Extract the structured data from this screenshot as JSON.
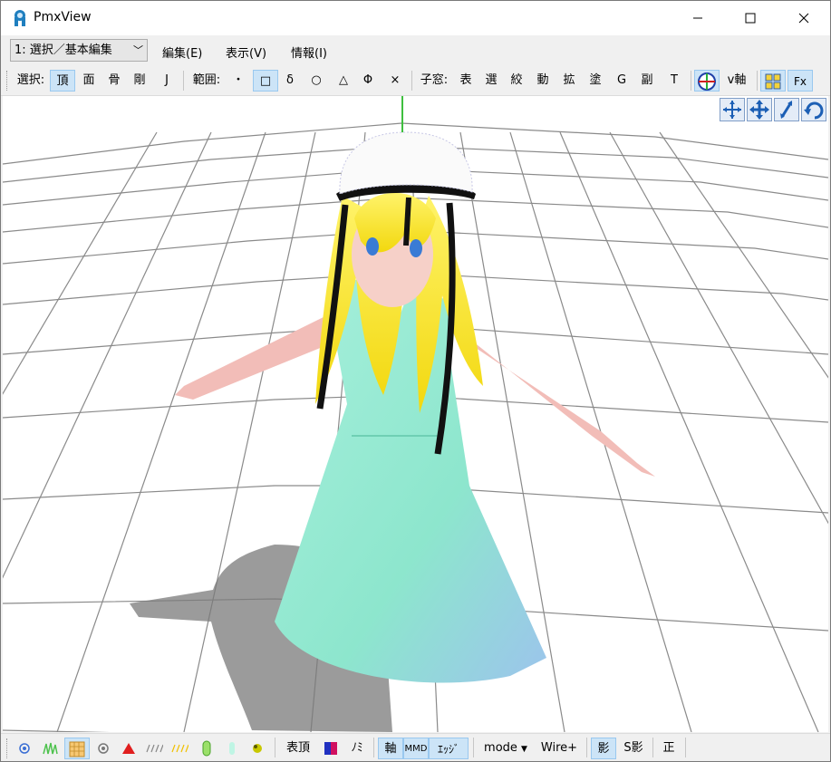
{
  "window": {
    "title": "PmxView"
  },
  "menu": {
    "mode_select": "1: 選択／基本編集",
    "items": [
      "編集(E)",
      "表示(V)",
      "情報(I)"
    ]
  },
  "toolbar": {
    "select_label": "選択:",
    "select_items": [
      "頂",
      "面",
      "骨",
      "剛",
      "J"
    ],
    "range_label": "範囲:",
    "range_items": [
      "・",
      "□",
      "δ",
      "○",
      "△",
      "Φ",
      "×"
    ],
    "child_label": "子窓:",
    "child_items": [
      "表",
      "選",
      "絞",
      "動",
      "拡",
      "塗",
      "G",
      "副",
      "T"
    ],
    "axis_label": "v軸",
    "fx_label": "Fx"
  },
  "statusbar": {
    "surface_label": "表頂",
    "mi_label": "ﾉﾐ",
    "axis_label": "軸",
    "mmd_label": "MMD",
    "edge_label": "ｴｯｼﾞ",
    "mode_label": "mode",
    "wire_label": "Wire+",
    "shadow_label": "影",
    "sshadow_label": "S影",
    "ortho_label": "正"
  },
  "colors": {
    "hair": "#f8e82c",
    "dress": "#8fe8cf",
    "skin": "#f4c4be",
    "selected": "#cce4f7"
  }
}
